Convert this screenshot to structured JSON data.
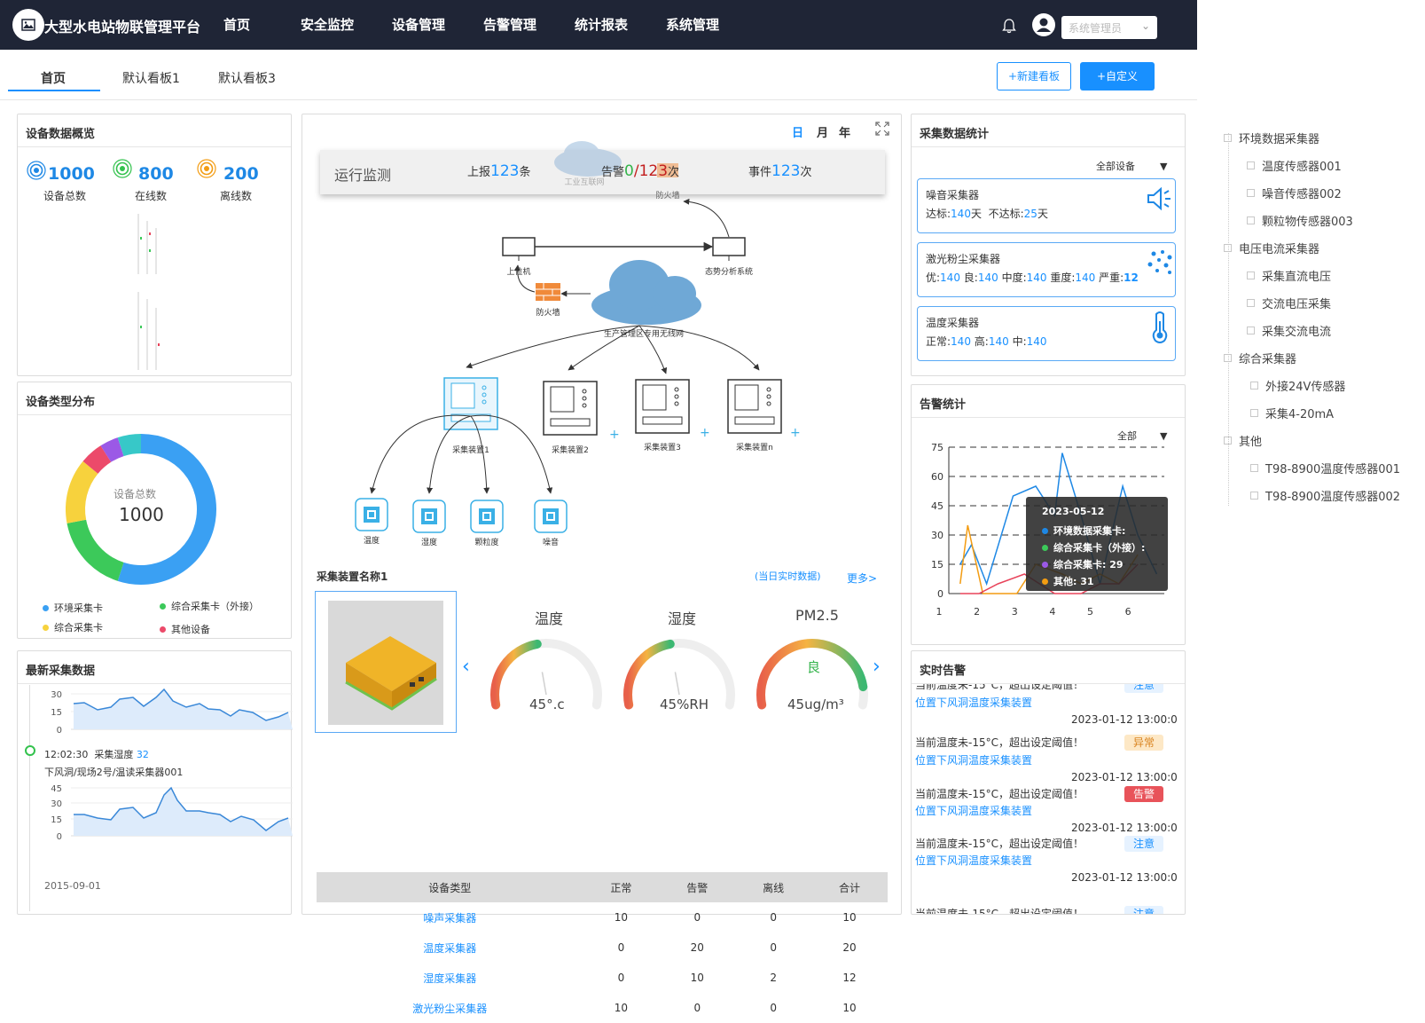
{
  "app": {
    "title": "大型水电站物联管理平台",
    "user": "系统管理员"
  },
  "nav": [
    "首页",
    "安全监控",
    "设备管理",
    "告警管理",
    "统计报表",
    "系统管理"
  ],
  "tabs": [
    "首页",
    "默认看板1",
    "默认看板3"
  ],
  "buttons": {
    "new_board": "+新建看板",
    "custom": "+自定义"
  },
  "overview": {
    "title": "设备数据概览",
    "total": "1000",
    "total_label": "设备总数",
    "online": "800",
    "online_label": "在线数",
    "offline": "200",
    "offline_label": "离线数"
  },
  "device_type": {
    "title": "设备类型分布",
    "center_label": "设备总数",
    "center_value": "1000",
    "legend": [
      {
        "name": "环境采集卡",
        "color": "#3aa0f3"
      },
      {
        "name": "综合采集卡（外接）",
        "color": "#3cc95a"
      },
      {
        "name": "综合采集卡",
        "color": "#f7d23d"
      },
      {
        "name": "其他设备",
        "color": "#ec4a6a"
      }
    ],
    "slices": [
      {
        "value": 55,
        "color": "#3aa0f3"
      },
      {
        "value": 17,
        "color": "#3cc95a"
      },
      {
        "value": 14,
        "color": "#f7d23d"
      },
      {
        "value": 5,
        "color": "#ec4a6a"
      },
      {
        "value": 4,
        "color": "#9b59e6"
      },
      {
        "value": 5,
        "color": "#37c8c8"
      }
    ]
  },
  "latest": {
    "title": "最新采集数据",
    "entry_time": "12:02:30",
    "entry_label": "采集湿度",
    "entry_value": "32",
    "entry_path": "下风洞/现场2号/温读采集器001",
    "bottom_date": "2015-09-01",
    "chart1_ticks": [
      "30",
      "15",
      "0"
    ],
    "chart2_ticks": [
      "45",
      "30",
      "15",
      "0"
    ]
  },
  "center": {
    "period": [
      "日",
      "月",
      "年"
    ],
    "monitor_title": "运行监测",
    "report_prefix": "上报",
    "report_value": "123",
    "report_unit": "条",
    "alarm_prefix": "告警",
    "alarm_green": "0",
    "alarm_sep": "/",
    "alarm_red": "123",
    "alarm_unit": "次",
    "event_prefix": "事件",
    "event_value": "123",
    "event_unit": "次",
    "diagram": {
      "cloud_top": "工业互联网",
      "firewall_top": "防火墙",
      "host": "上位机",
      "situation": "态势分析系统",
      "firewall_left": "防火墙",
      "cloud_main": "生产管理区专用无线网",
      "collectors": [
        "采集装置1",
        "采集装置2",
        "采集装置3",
        "采集装置n"
      ],
      "sensors": [
        "温度",
        "湿度",
        "颗粒度",
        "噪音"
      ]
    },
    "device_name": "采集装置名称1",
    "realtime_link": "(当日实时数据)",
    "more_link": "更多>",
    "gauges": [
      {
        "title": "温度",
        "value": "45°.c",
        "ratio": 0.45
      },
      {
        "title": "湿度",
        "value": "45%RH",
        "ratio": 0.45
      },
      {
        "title": "PM2.5",
        "value": "45ug/m³",
        "label": "良",
        "ratio": 0.9
      }
    ],
    "table_headers": [
      "设备类型",
      "正常",
      "告警",
      "离线",
      "合计"
    ],
    "table_rows": [
      [
        "噪声采集器",
        "10",
        "0",
        "0",
        "10"
      ],
      [
        "温度采集器",
        "0",
        "20",
        "0",
        "20"
      ],
      [
        "湿度采集器",
        "0",
        "10",
        "2",
        "12"
      ],
      [
        "激光粉尘采集器",
        "10",
        "0",
        "0",
        "10"
      ]
    ]
  },
  "collect_stats": {
    "title": "采集数据统计",
    "filter": "全部设备",
    "cards": [
      {
        "title": "噪音采集器",
        "p1": "达标:",
        "v1": "140",
        "u1": "天",
        "p2": "不达标:",
        "v2": "25",
        "u2": "天"
      },
      {
        "title": "激光粉尘采集器",
        "p1": "优:",
        "v1": "140",
        "p2": "良:",
        "v2": "140",
        "p3": "中度:",
        "v3": "140",
        "p4": "重度:",
        "v4": "140",
        "p5": "严重:",
        "v5": "12"
      },
      {
        "title": "温度采集器",
        "p1": "正常:",
        "v1": "140",
        "p2": "高:",
        "v2": "140",
        "p3": "中:",
        "v3": "140"
      }
    ]
  },
  "alarm_stats": {
    "title": "告警统计",
    "filter": "全部",
    "tooltip": {
      "date": "2023-05-12",
      "rows": [
        {
          "name": "环境数据采集卡:",
          "color": "#1e88e5"
        },
        {
          "name": "综合采集卡（外接）:",
          "color": "#3cc95a"
        },
        {
          "name": "综合采集卡: 29",
          "color": "#9b59e6"
        },
        {
          "name": "其他: 31",
          "color": "#f39c12"
        }
      ]
    }
  },
  "chart_data": {
    "type": "line",
    "title": "",
    "x": [
      "1",
      "2",
      "3",
      "4",
      "5",
      "6"
    ],
    "y_ticks": [
      "75",
      "60",
      "45",
      "30",
      "15",
      "0"
    ],
    "ylim": [
      0,
      75
    ],
    "series": [
      {
        "name": "环境数据采集卡",
        "color": "#1e88e5",
        "values": [
          [
            1.3,
            15
          ],
          [
            1.6,
            25
          ],
          [
            2.0,
            5
          ],
          [
            2.7,
            50
          ],
          [
            3.3,
            55
          ],
          [
            3.8,
            40
          ],
          [
            4.0,
            72
          ],
          [
            4.5,
            40
          ],
          [
            5.0,
            5
          ],
          [
            5.6,
            55
          ],
          [
            6.0,
            30
          ],
          [
            6.5,
            10
          ]
        ]
      },
      {
        "name": "其他",
        "color": "#f39c12",
        "values": [
          [
            1.3,
            5
          ],
          [
            1.5,
            35
          ],
          [
            1.9,
            0
          ],
          [
            2.3,
            0
          ],
          [
            2.8,
            0
          ],
          [
            3.3,
            15
          ],
          [
            4.0,
            10
          ],
          [
            4.5,
            5
          ],
          [
            5.0,
            10
          ],
          [
            5.5,
            5
          ],
          [
            6.0,
            20
          ]
        ]
      },
      {
        "name": "综合采集卡",
        "color": "#e8435a",
        "values": [
          [
            1.3,
            0
          ],
          [
            1.8,
            0
          ],
          [
            2.3,
            5
          ],
          [
            3.0,
            10
          ],
          [
            3.8,
            0
          ],
          [
            4.5,
            0
          ],
          [
            5.0,
            5
          ],
          [
            5.5,
            5
          ],
          [
            6.0,
            15
          ]
        ]
      }
    ]
  },
  "realtime_alarm": {
    "title": "实时告警",
    "items": [
      {
        "msg": "当前温度未-15°C，超出设定阈值！",
        "loc": "位置下风洞温度采集装置",
        "time": "2023-01-12 13:00:0",
        "badge": "注意",
        "bg": "#e6f2ff",
        "fg": "#1890ff"
      },
      {
        "msg": "当前温度未-15°C，超出设定阈值！",
        "loc": "位置下风洞温度采集装置",
        "time": "2023-01-12 13:00:0",
        "badge": "异常",
        "bg": "#fde8c6",
        "fg": "#d9831f"
      },
      {
        "msg": "当前温度未-15°C，超出设定阈值！",
        "loc": "位置下风洞温度采集装置",
        "time": "2023-01-12 13:00:0",
        "badge": "告警",
        "bg": "#e8535a",
        "fg": "#fff"
      },
      {
        "msg": "当前温度未-15°C，超出设定阈值！",
        "loc": "位置下风洞温度采集装置",
        "time": "2023-01-12 13:00:0",
        "badge": "注意",
        "bg": "#e6f2ff",
        "fg": "#1890ff"
      },
      {
        "msg": "当前温度未-15°C，超出设定阈值！",
        "loc": "",
        "time": "",
        "badge": "注意",
        "bg": "#e6f2ff",
        "fg": "#1890ff"
      }
    ]
  },
  "tree": [
    {
      "label": "环境数据采集器",
      "level": 0
    },
    {
      "label": "温度传感器001",
      "level": 1
    },
    {
      "label": "噪音传感器002",
      "level": 1
    },
    {
      "label": "颗粒物传感器003",
      "level": 1
    },
    {
      "label": "电压电流采集器",
      "level": 0
    },
    {
      "label": "采集直流电压",
      "level": 1
    },
    {
      "label": "交流电压采集",
      "level": 1
    },
    {
      "label": "采集交流电流",
      "level": 1
    },
    {
      "label": "综合采集器",
      "level": 0
    },
    {
      "label": "外接24V传感器",
      "level": 1
    },
    {
      "label": "采集4-20mA",
      "level": 1
    },
    {
      "label": "其他",
      "level": 0
    },
    {
      "label": "T98-8900温度传感器001",
      "level": 1
    },
    {
      "label": "T98-8900温度传感器002",
      "level": 1
    }
  ]
}
